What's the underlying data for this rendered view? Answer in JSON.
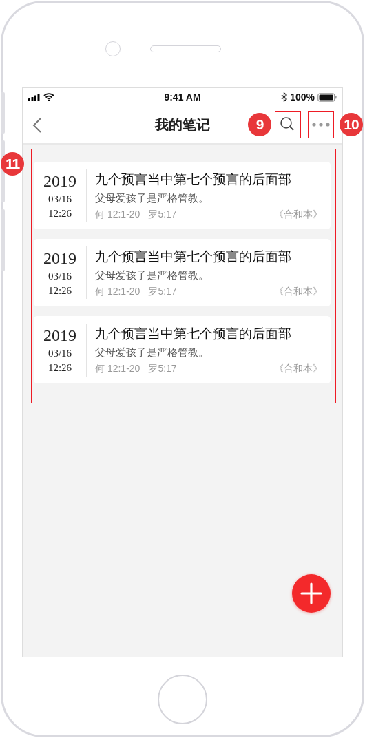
{
  "status_bar": {
    "time": "9:41 AM",
    "battery": "100%"
  },
  "nav": {
    "title": "我的笔记"
  },
  "notes": [
    {
      "year": "2019",
      "date": "03/16",
      "time": "12:26",
      "title": "九个预言当中第七个预言的后面部",
      "excerpt": "父母爱孩子是严格管教。",
      "refs": [
        "何 12:1-20",
        "罗5:17"
      ],
      "version": "《合和本》"
    },
    {
      "year": "2019",
      "date": "03/16",
      "time": "12:26",
      "title": "九个预言当中第七个预言的后面部",
      "excerpt": "父母爱孩子是严格管教。",
      "refs": [
        "何 12:1-20",
        "罗5:17"
      ],
      "version": "《合和本》"
    },
    {
      "year": "2019",
      "date": "03/16",
      "time": "12:26",
      "title": "九个预言当中第七个预言的后面部",
      "excerpt": "父母爱孩子是严格管教。",
      "refs": [
        "何 12:1-20",
        "罗5:17"
      ],
      "version": "《合和本》"
    }
  ],
  "annotations": [
    {
      "label": "9"
    },
    {
      "label": "10"
    },
    {
      "label": "11"
    }
  ]
}
